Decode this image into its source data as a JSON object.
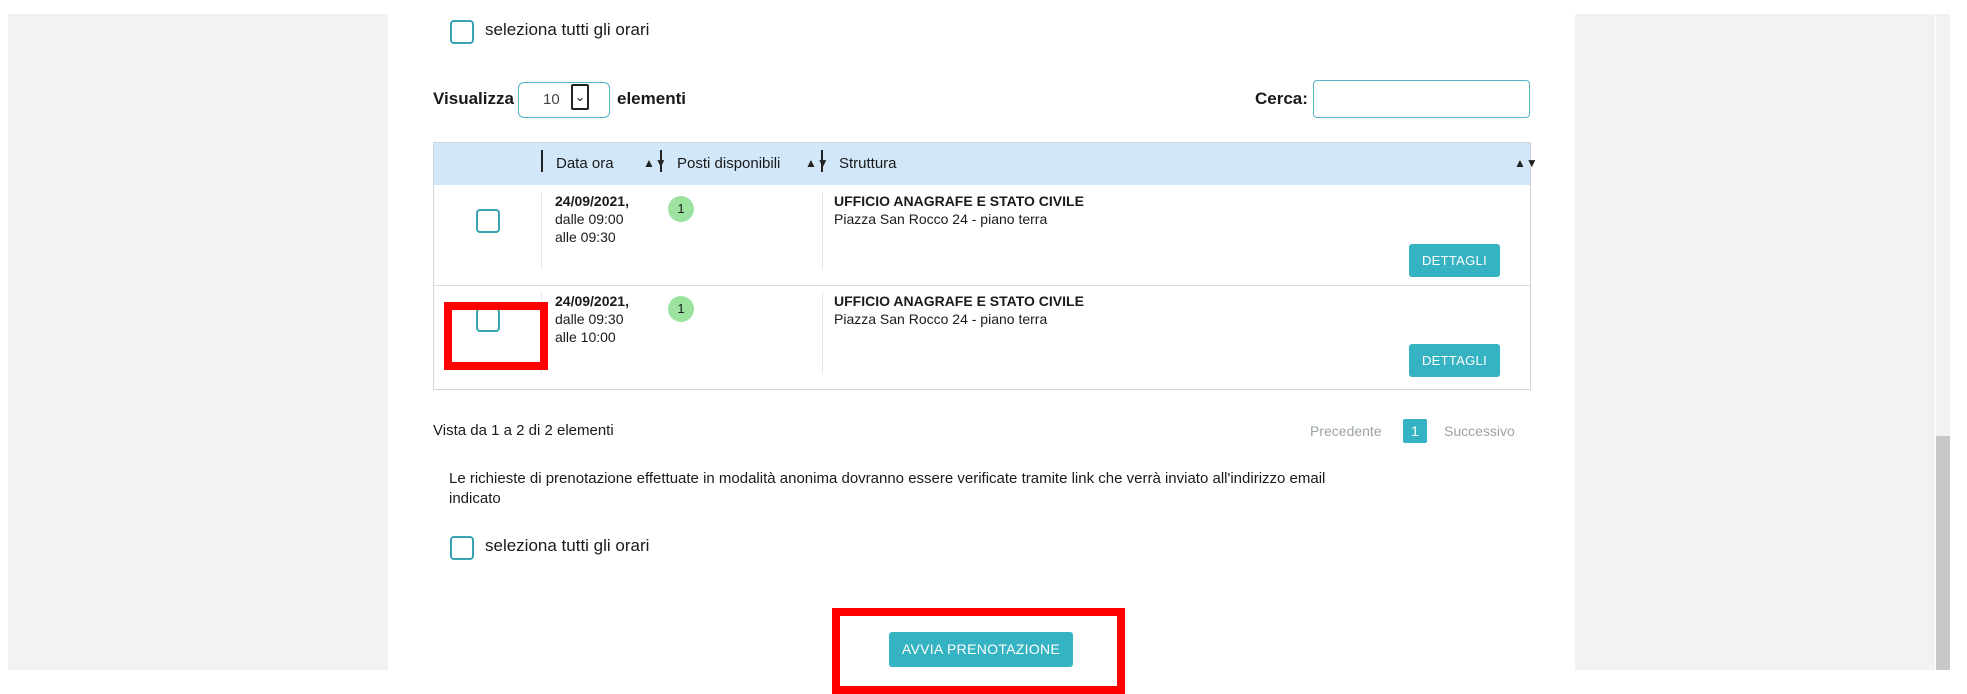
{
  "select_all_label": "seleziona tutti gli orari",
  "length_menu": {
    "prefix": "Visualizza",
    "value": "10",
    "suffix": "elementi"
  },
  "search": {
    "label": "Cerca:",
    "value": ""
  },
  "table": {
    "columns": [
      "Data ora",
      "Posti disponibili",
      "Struttura"
    ],
    "rows": [
      {
        "date": "24/09/2021,",
        "from": "dalle 09:00",
        "to": "alle 09:30",
        "available": "1",
        "structure_name": "UFFICIO ANAGRAFE E STATO CIVILE",
        "structure_address": "Piazza San Rocco 24 - piano terra",
        "details_label": "DETTAGLI"
      },
      {
        "date": "24/09/2021,",
        "from": "dalle 09:30",
        "to": "alle 10:00",
        "available": "1",
        "structure_name": "UFFICIO ANAGRAFE E STATO CIVILE",
        "structure_address": "Piazza San Rocco 24 - piano terra",
        "details_label": "DETTAGLI"
      }
    ]
  },
  "info": "Vista da 1 a 2 di 2 elementi",
  "pagination": {
    "prev": "Precedente",
    "current": "1",
    "next": "Successivo"
  },
  "notice_line1": "Le richieste di prenotazione effettuate in modalità anonima dovranno essere verificate tramite link che verrà inviato all'indirizzo email",
  "notice_line2": "indicato",
  "submit_label": "AVVIA PRENOTAZIONE",
  "colors": {
    "accent": "#36b3c2",
    "header_bg": "#d2e8fa",
    "badge": "#9be39e",
    "highlight": "#ff0000"
  }
}
